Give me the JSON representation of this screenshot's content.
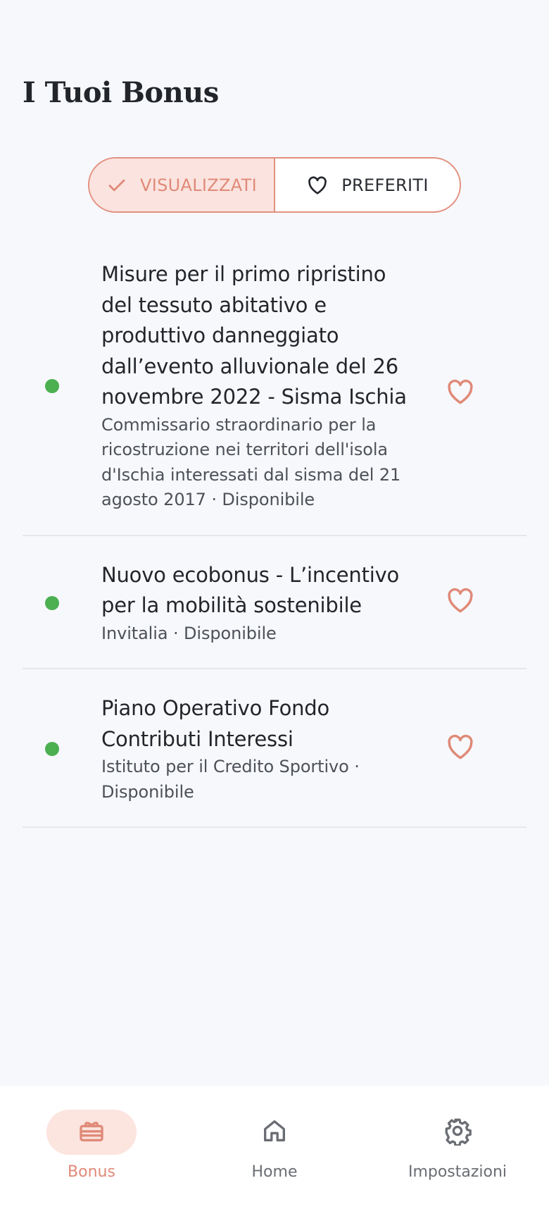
{
  "page": {
    "title": "I Tuoi Bonus"
  },
  "tabs": [
    {
      "label": "VISUALIZZATI",
      "icon": "check-icon",
      "active": true
    },
    {
      "label": "PREFERITI",
      "icon": "heart-outline-icon",
      "active": false
    }
  ],
  "items": [
    {
      "title": "Misure per il primo ripristino del tessuto abitativo e produttivo danneggiato dall’evento alluvionale del 26 novembre 2022 - Sisma Ischia",
      "subtitle": "Commissario straordinario per la ricostruzione nei territori dell'isola d'Ischia interessati dal sisma del 21 agosto 2017 · Disponibile",
      "status_color": "#4caf50"
    },
    {
      "title": "Nuovo ecobonus - L’incentivo per la mobilità sostenibile",
      "subtitle": "Invitalia · Disponibile",
      "status_color": "#4caf50"
    },
    {
      "title": "Piano Operativo Fondo Contributi Interessi",
      "subtitle": "Istituto per il Credito Sportivo · Disponibile",
      "status_color": "#4caf50"
    }
  ],
  "nav": [
    {
      "label": "Bonus",
      "icon": "gift-icon",
      "active": true
    },
    {
      "label": "Home",
      "icon": "home-icon",
      "active": false
    },
    {
      "label": "Impostazioni",
      "icon": "gear-icon",
      "active": false
    }
  ],
  "colors": {
    "accent": "#e08a78",
    "accent_bg": "#fbe3df",
    "status_available": "#4caf50",
    "background": "#f7f8fc"
  }
}
